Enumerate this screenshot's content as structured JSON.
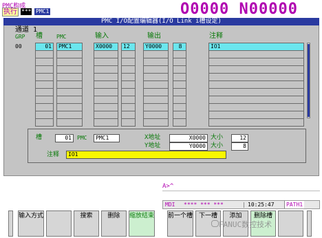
{
  "top": {
    "title": "PMC构成",
    "exec_label": "执行",
    "exec_stars": "***",
    "exec_name": "PMC1",
    "prog_number": "O0000 N00000"
  },
  "header": {
    "title": "PMC I/O配置编辑器(I/O Link i槽设定)"
  },
  "columns": {
    "channel_label": "通道 1",
    "grp": "GRP",
    "slot": "槽",
    "pmc": "PMC",
    "input": "输入",
    "output": "输出",
    "comment": "注释"
  },
  "rows": [
    {
      "grp": "00",
      "slot": "01",
      "pmc": "PMC1",
      "x_addr": "X0000",
      "x_size": "12",
      "y_addr": "Y0000",
      "y_size": "8",
      "comment": "IO1"
    }
  ],
  "detail": {
    "slot_label": "槽",
    "slot_value": "01",
    "pmc_label": "PMC",
    "pmc_value": "PMC1",
    "x_addr_label": "X地址",
    "x_addr_value": "X0000",
    "x_size_label": "大小",
    "x_size_value": "12",
    "y_addr_label": "Y地址",
    "y_addr_value": "Y0000",
    "y_size_label": "大小",
    "y_size_value": "8",
    "comment_label": "注释",
    "comment_value": "IO1"
  },
  "prompt": "A>^",
  "status": {
    "mode": "MDI",
    "stars": "**** *** ***",
    "sep": "|",
    "time": "10:25:47",
    "path": "PATH1"
  },
  "softkeys": {
    "left_arrow": "",
    "k1": "输入方式",
    "k2": "",
    "k3": "搜索",
    "k4": "删除",
    "k5": "缩放结束",
    "k6": "前一个槽",
    "k7": "下一槽",
    "k8": "添加",
    "k9": "删除槽",
    "right_arrow": ""
  },
  "watermark": "FANUC数控技术",
  "colors": {
    "header_blue": "#2a3aa0",
    "magenta": "#b000b0",
    "cyan_select": "#6be6ee",
    "label_green": "#0a7a0a",
    "comment_yellow": "#f8f700"
  }
}
